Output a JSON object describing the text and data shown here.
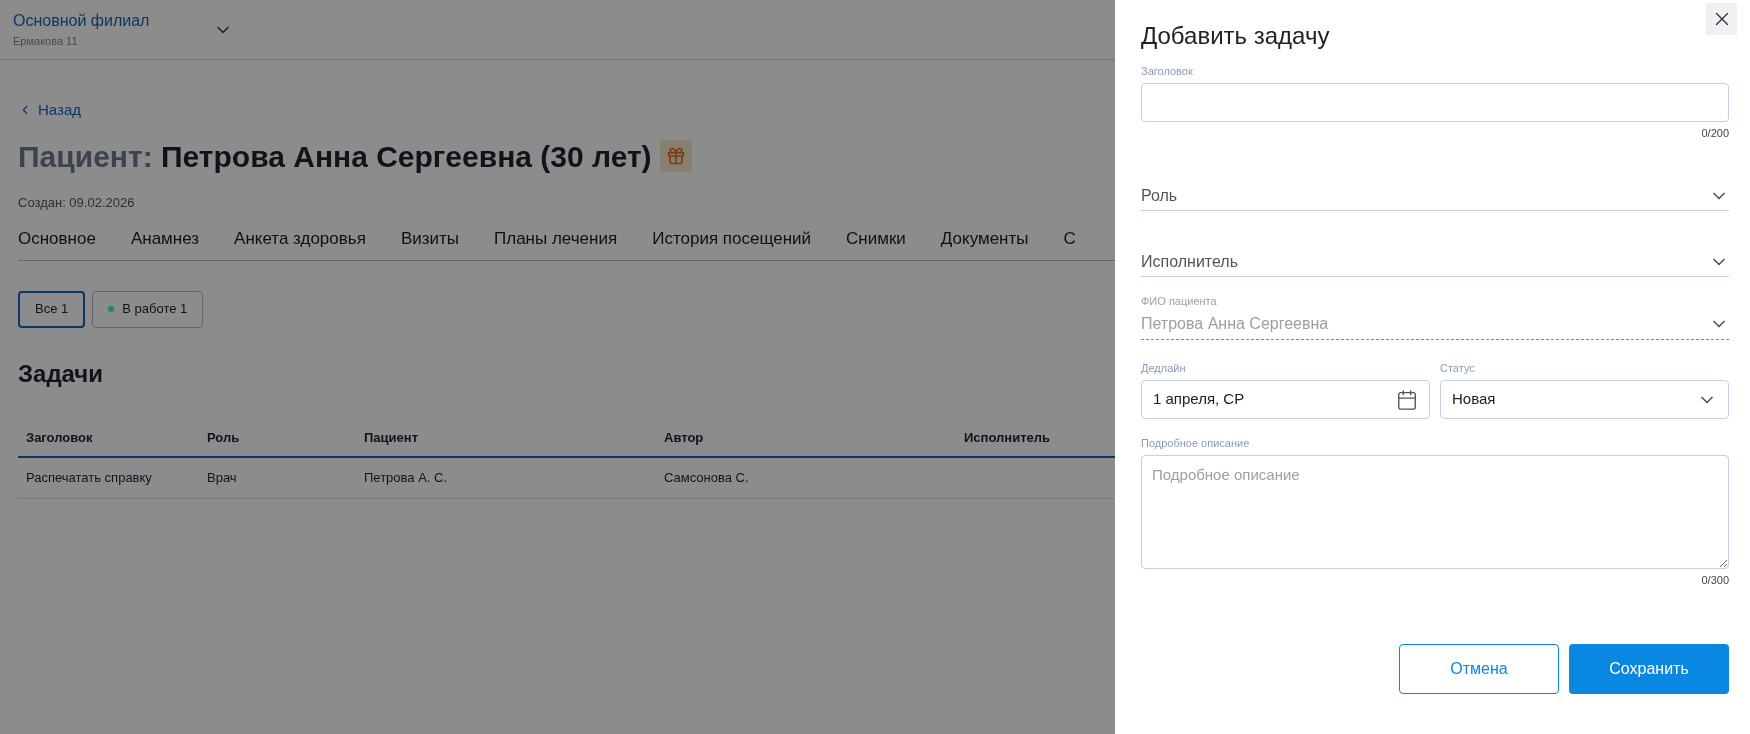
{
  "header": {
    "branch": "Основной филиал",
    "address": "Ермакова 11"
  },
  "back_link": "Назад",
  "patient": {
    "label": "Пациент:",
    "name": "Петрова Анна Сергеевна (30 лет)",
    "birthday": true
  },
  "created": "Создан: 09.02.2026",
  "tabs": [
    "Основное",
    "Анамнез",
    "Анкета здоровья",
    "Визиты",
    "Планы лечения",
    "История посещений",
    "Снимки",
    "Документы",
    "С"
  ],
  "filters": [
    {
      "label": "Все 1",
      "selected": true
    },
    {
      "label": "В работе 1",
      "selected": false,
      "color": "#1e8c46"
    }
  ],
  "section_title": "Задачи",
  "table": {
    "columns": [
      "Заголовок",
      "Роль",
      "Пациент",
      "Автор",
      "Исполнитель"
    ],
    "rows": [
      [
        "Распечатать справку",
        "Врач",
        "Петрова А. С.",
        "Самсонова С."
      ]
    ]
  },
  "drawer": {
    "title": "Добавить задачу",
    "fields": [
      {
        "kind": "input",
        "label": "Заголовок",
        "counter": "0/200"
      },
      {
        "kind": "select",
        "placeholder": "Роль",
        "disabled": false
      },
      {
        "kind": "select",
        "placeholder": "Исполнитель",
        "disabled": false
      },
      {
        "kind": "select",
        "label": "ФИО пациента",
        "value": "Петрова Анна Сергеевна",
        "disabled": true
      },
      {
        "kind": "row",
        "items": [
          {
            "kind": "date",
            "label": "Дедлайн",
            "value": "1 апреля, СР"
          },
          {
            "kind": "dropdown",
            "label": "Статус",
            "value": "Новая"
          }
        ]
      },
      {
        "kind": "textarea",
        "label": "Подробное описание",
        "placeholder": "Подробное описание",
        "counter": "0/300"
      }
    ],
    "buttons": [
      {
        "label": "Отмена",
        "kind": "secondary"
      },
      {
        "label": "Сохранить",
        "kind": "primary"
      }
    ]
  }
}
